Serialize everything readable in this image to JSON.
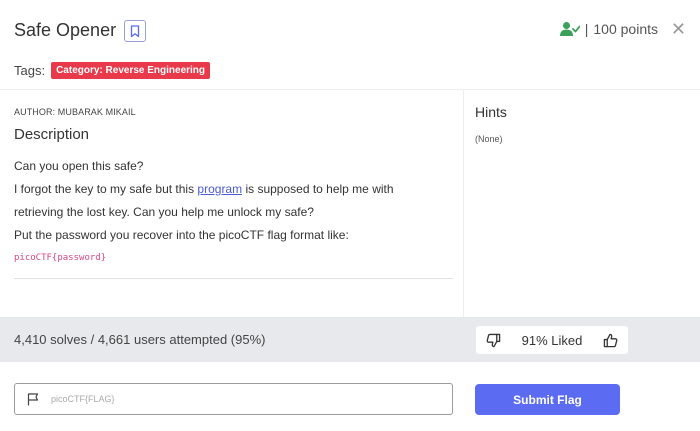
{
  "challenge": {
    "title": "Safe Opener",
    "points_label": "100 points",
    "points_separator": "|",
    "close_glyph": "✕",
    "user_icon_color": "#3aa05a"
  },
  "tags": {
    "label": "Tags:",
    "badge": "Category: Reverse Engineering",
    "badge_color": "#e83a4b"
  },
  "description": {
    "author": "AUTHOR: MUBARAK MIKAIL",
    "heading": "Description",
    "line1": "Can you open this safe?",
    "line2_pre": "I forgot the key to my safe but this ",
    "line2_link": "program",
    "line2_post": " is supposed to help me with",
    "line3": "retrieving the lost key. Can you help me unlock my safe?",
    "line4": "Put the password you recover into the picoCTF flag format like:",
    "code": "picoCTF{password}"
  },
  "hints": {
    "heading": "Hints",
    "body": "(None)"
  },
  "stats": {
    "solves": "4,410 solves / 4,661 users attempted (95%)",
    "liked": "91% Liked"
  },
  "flag_form": {
    "placeholder": "picoCTF{FLAG}",
    "submit_label": "Submit Flag",
    "submit_color": "#5b6cf2"
  }
}
